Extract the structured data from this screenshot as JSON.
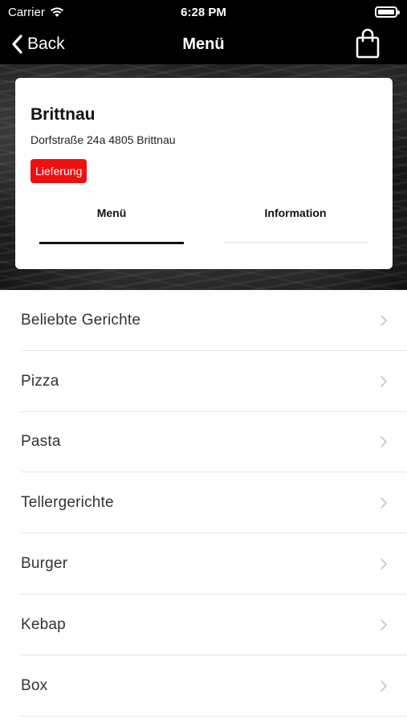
{
  "status_bar": {
    "carrier": "Carrier",
    "time": "6:28 PM"
  },
  "nav": {
    "back_label": "Back",
    "title": "Menü"
  },
  "restaurant": {
    "name": "Brittnau",
    "address": "Dorfstraße 24a 4805 Brittnau",
    "badge": "Lieferung"
  },
  "tabs": [
    {
      "label": "Menü",
      "active": true
    },
    {
      "label": "Information",
      "active": false
    }
  ],
  "categories": [
    {
      "label": "Beliebte Gerichte"
    },
    {
      "label": "Pizza"
    },
    {
      "label": "Pasta"
    },
    {
      "label": "Tellergerichte"
    },
    {
      "label": "Burger"
    },
    {
      "label": "Kebap"
    },
    {
      "label": "Box"
    }
  ],
  "colors": {
    "badge": "#f00f0f",
    "bar": "#000000"
  },
  "icons": {
    "wifi": "wifi-icon",
    "battery": "battery-icon",
    "back": "chevron-left-icon",
    "cart": "shopping-bag-icon",
    "row": "chevron-right-icon"
  }
}
